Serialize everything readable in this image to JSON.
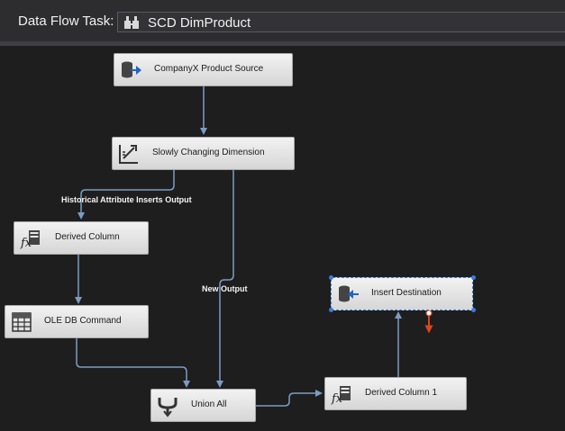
{
  "header": {
    "label": "Data Flow Task:",
    "task_name": "SCD DimProduct",
    "task_icon": "data-flow-task-icon"
  },
  "components": {
    "source": {
      "label": "CompanyX Product Source",
      "icon": "oledb-source-icon"
    },
    "scd": {
      "label": "Slowly Changing Dimension",
      "icon": "slowly-changing-dimension-icon"
    },
    "derived1": {
      "label": "Derived Column",
      "icon": "derived-column-icon"
    },
    "oledbcmd": {
      "label": "OLE DB Command",
      "icon": "oledb-command-icon"
    },
    "union": {
      "label": "Union All",
      "icon": "union-all-icon"
    },
    "derived2": {
      "label": "Derived Column 1",
      "icon": "derived-column-icon"
    },
    "dest": {
      "label": "Insert Destination",
      "icon": "oledb-destination-icon"
    }
  },
  "paths": {
    "historical": "Historical Attribute Inserts Output",
    "new_output": "New Output"
  },
  "colors": {
    "canvas": "#1e1e1e",
    "path": "#7b9cc4",
    "error_path": "#d9471d",
    "selection": "#3b7dd8"
  }
}
